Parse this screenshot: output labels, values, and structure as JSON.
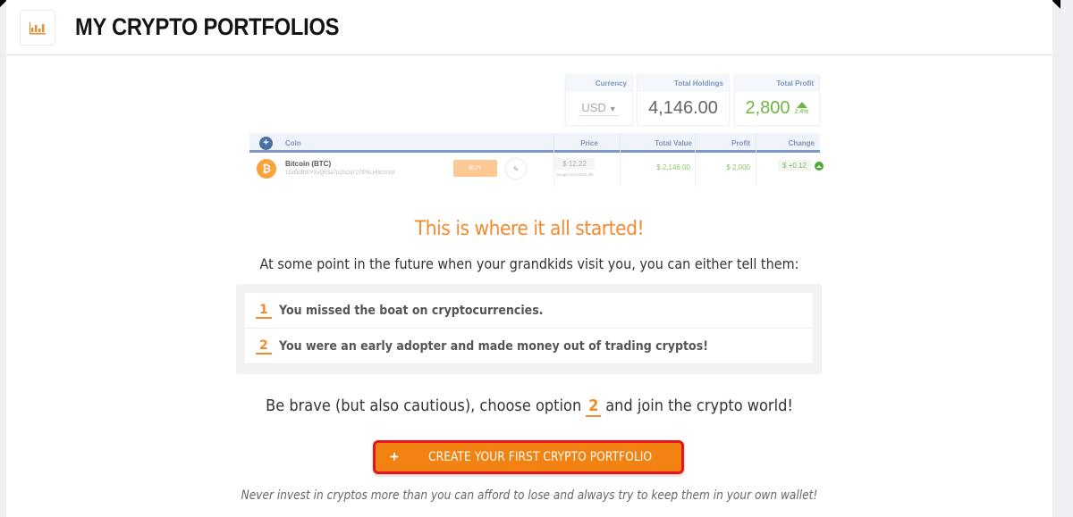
{
  "header": {
    "icon": "bar-chart-icon",
    "title": "MY CRYPTO PORTFOLIOS"
  },
  "preview": {
    "stats": {
      "currency_label": "Currency",
      "currency_value": "USD",
      "holdings_label": "Total Holdings",
      "holdings_value": "4,146.00",
      "profit_label": "Total Profit",
      "profit_value": "2,800",
      "profit_change_pct": "2.4%"
    },
    "table": {
      "columns": [
        "Coin",
        "Price",
        "Total Value",
        "Profit",
        "Change"
      ],
      "rows": [
        {
          "coin_name": "Bitcoin (BTC)",
          "coin_symbol_icon": "bitcoin-icon",
          "address": "1Dd9eBtKYXxQhSa7pZN2qT27fP8LHWzSX8",
          "buy_label": "BUY",
          "price": "$ 12.22",
          "price_sub": "bought at 0.0002, $5",
          "total_value": "$ 2,146.00",
          "profit": "$ 2,000",
          "change": "$ +0.12"
        }
      ]
    }
  },
  "main": {
    "headline": "This is where it all started!",
    "intro": "At some point in the future when your grandkids visit you, you can either tell them:",
    "options": [
      {
        "number": "1",
        "text": "You missed the boat on cryptocurrencies."
      },
      {
        "number": "2",
        "text": "You were an early adopter and made money out of trading cryptos!"
      }
    ],
    "cta_before": "Be brave (but also cautious), choose option",
    "cta_option": "2",
    "cta_after": "and join the crypto world!",
    "create_button_label": "CREATE YOUR FIRST CRYPTO PORTFOLIO",
    "disclaimer": "Never invest in cryptos more than you can afford to lose and always try to keep them in your own wallet!"
  },
  "colors": {
    "accent": "#f58a2d",
    "button_bg": "#f28211",
    "button_border": "#e8141b",
    "profit_green": "#6fb543",
    "table_header_blue": "#7b98c6"
  }
}
